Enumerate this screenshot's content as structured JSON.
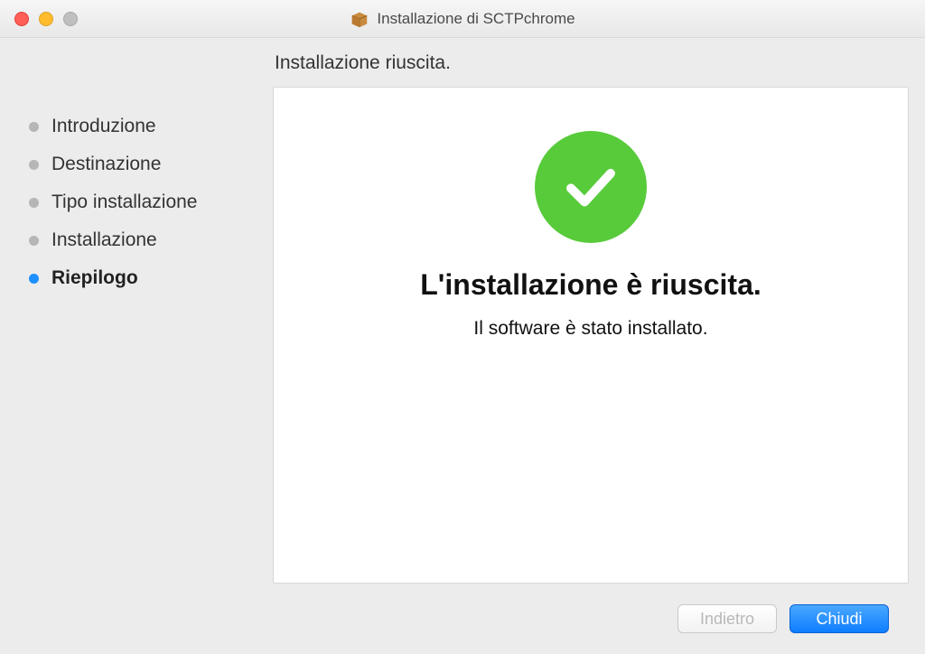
{
  "window": {
    "title": "Installazione di SCTPchrome"
  },
  "sidebar": {
    "steps": [
      {
        "label": "Introduzione",
        "active": false
      },
      {
        "label": "Destinazione",
        "active": false
      },
      {
        "label": "Tipo installazione",
        "active": false
      },
      {
        "label": "Installazione",
        "active": false
      },
      {
        "label": "Riepilogo",
        "active": true
      }
    ]
  },
  "main": {
    "status_heading": "Installazione riuscita.",
    "success_title": "L'installazione è riuscita.",
    "success_sub": "Il software è stato installato."
  },
  "footer": {
    "back_label": "Indietro",
    "close_label": "Chiudi"
  },
  "colors": {
    "success_green": "#58cb3b",
    "primary_blue": "#0e7dff"
  }
}
